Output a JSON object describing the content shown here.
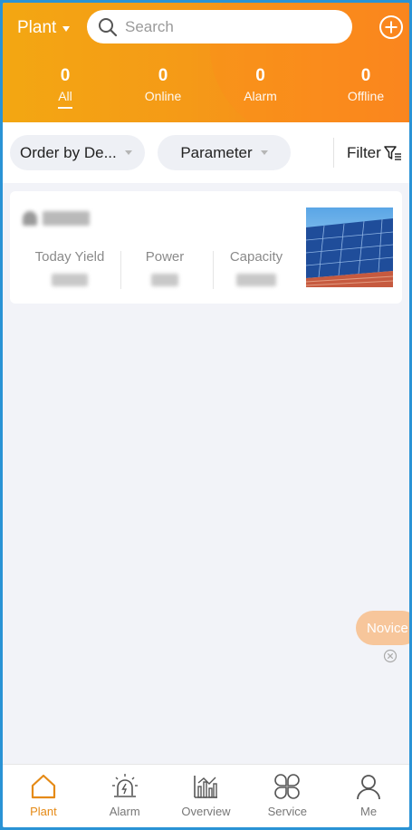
{
  "header": {
    "plant_selector": "Plant",
    "search_placeholder": "Search",
    "stats": [
      {
        "value": "0",
        "label": "All",
        "active": true
      },
      {
        "value": "0",
        "label": "Online"
      },
      {
        "value": "0",
        "label": "Alarm"
      },
      {
        "value": "0",
        "label": "Offline"
      }
    ]
  },
  "filters": {
    "order_label": "Order by De...",
    "parameter_label": "Parameter",
    "filter_label": "Filter"
  },
  "plant_card": {
    "metrics": [
      {
        "label": "Today Yield"
      },
      {
        "label": "Power"
      },
      {
        "label": "Capacity"
      }
    ]
  },
  "floating": {
    "novice_label": "Novice"
  },
  "bottom_nav": [
    {
      "label": "Plant",
      "icon": "house-icon",
      "active": true
    },
    {
      "label": "Alarm",
      "icon": "alarm-siren-icon"
    },
    {
      "label": "Overview",
      "icon": "bar-chart-icon"
    },
    {
      "label": "Service",
      "icon": "clover-grid-icon"
    },
    {
      "label": "Me",
      "icon": "person-icon"
    }
  ],
  "colors": {
    "accent": "#f59a17",
    "active_nav": "#e58a16",
    "frame": "#2a93d5"
  }
}
